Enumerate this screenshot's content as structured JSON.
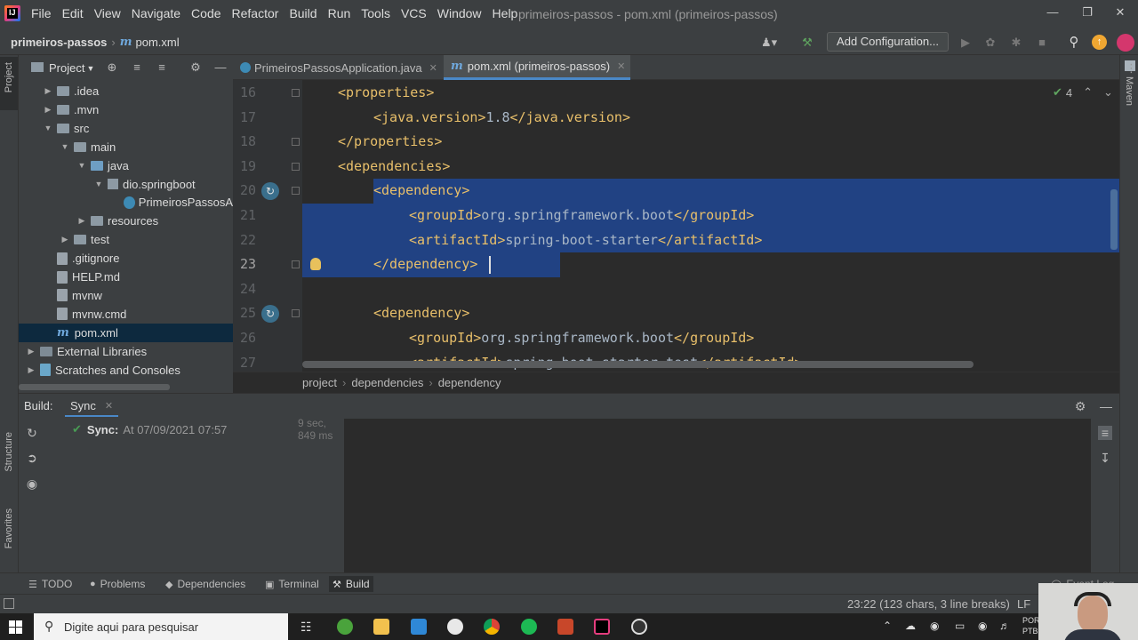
{
  "menubar": {
    "items": [
      "File",
      "Edit",
      "View",
      "Navigate",
      "Code",
      "Refactor",
      "Build",
      "Run",
      "Tools",
      "VCS",
      "Window",
      "Help"
    ],
    "window_title": "primeiros-passos - pom.xml (primeiros-passos)"
  },
  "navbar": {
    "project": "primeiros-passos",
    "file": "pom.xml",
    "add_configuration": "Add Configuration..."
  },
  "left_strip": {
    "project": "Project",
    "structure": "Structure",
    "favorites": "Favorites"
  },
  "right_strip": {
    "maven": "Maven"
  },
  "project_panel": {
    "title": "Project",
    "tree": [
      {
        "label": ".idea",
        "depth": 1,
        "kind": "folder",
        "expand": "collapsed"
      },
      {
        "label": ".mvn",
        "depth": 1,
        "kind": "folder",
        "expand": "collapsed"
      },
      {
        "label": "src",
        "depth": 1,
        "kind": "folder",
        "expand": "expanded"
      },
      {
        "label": "main",
        "depth": 2,
        "kind": "folder",
        "expand": "expanded"
      },
      {
        "label": "java",
        "depth": 3,
        "kind": "folder-blue",
        "expand": "expanded"
      },
      {
        "label": "dio.springboot",
        "depth": 4,
        "kind": "package",
        "expand": "expanded"
      },
      {
        "label": "PrimeirosPassosA",
        "depth": 5,
        "kind": "class",
        "expand": "none"
      },
      {
        "label": "resources",
        "depth": 3,
        "kind": "folder",
        "expand": "collapsed"
      },
      {
        "label": "test",
        "depth": 2,
        "kind": "folder",
        "expand": "collapsed"
      },
      {
        "label": ".gitignore",
        "depth": 1,
        "kind": "file",
        "expand": "none"
      },
      {
        "label": "HELP.md",
        "depth": 1,
        "kind": "file",
        "expand": "none"
      },
      {
        "label": "mvnw",
        "depth": 1,
        "kind": "file",
        "expand": "none"
      },
      {
        "label": "mvnw.cmd",
        "depth": 1,
        "kind": "file",
        "expand": "none"
      },
      {
        "label": "pom.xml",
        "depth": 1,
        "kind": "maven",
        "expand": "none",
        "selected": true
      },
      {
        "label": "External Libraries",
        "depth": 0,
        "kind": "libs",
        "expand": "collapsed"
      },
      {
        "label": "Scratches and Consoles",
        "depth": 0,
        "kind": "scratch",
        "expand": "collapsed"
      }
    ]
  },
  "editor_tabs": [
    {
      "label": "PrimeirosPassosApplication.java",
      "active": false
    },
    {
      "label": "pom.xml (primeiros-passos)",
      "active": true
    }
  ],
  "editor": {
    "inspection_count": "4",
    "lines": [
      {
        "num": "16",
        "indent": 1,
        "parts": [
          [
            "tag",
            "<properties>"
          ]
        ]
      },
      {
        "num": "17",
        "indent": 2,
        "parts": [
          [
            "tag",
            "<java.version>"
          ],
          [
            "txt",
            "1.8"
          ],
          [
            "tag",
            "</java.version>"
          ]
        ]
      },
      {
        "num": "18",
        "indent": 1,
        "parts": [
          [
            "tag",
            "</properties>"
          ]
        ]
      },
      {
        "num": "19",
        "indent": 1,
        "parts": [
          [
            "tag",
            "<dependencies>"
          ]
        ]
      },
      {
        "num": "20",
        "indent": 2,
        "parts": [
          [
            "tag",
            "<dependency>"
          ]
        ]
      },
      {
        "num": "21",
        "indent": 3,
        "parts": [
          [
            "tag",
            "<groupId>"
          ],
          [
            "txt",
            "org.springframework.boot"
          ],
          [
            "tag",
            "</groupId>"
          ]
        ]
      },
      {
        "num": "22",
        "indent": 3,
        "parts": [
          [
            "tag",
            "<artifactId>"
          ],
          [
            "txt",
            "spring-boot-starter"
          ],
          [
            "tag",
            "</artifactId>"
          ]
        ]
      },
      {
        "num": "23",
        "indent": 2,
        "parts": [
          [
            "tag",
            "</dependency>"
          ]
        ]
      },
      {
        "num": "24",
        "indent": 0,
        "parts": []
      },
      {
        "num": "25",
        "indent": 2,
        "parts": [
          [
            "tag",
            "<dependency>"
          ]
        ]
      },
      {
        "num": "26",
        "indent": 3,
        "parts": [
          [
            "tag",
            "<groupId>"
          ],
          [
            "txt",
            "org.springframework.boot"
          ],
          [
            "tag",
            "</groupId>"
          ]
        ]
      },
      {
        "num": "27",
        "indent": 3,
        "parts": [
          [
            "tag",
            "<artifactId>"
          ],
          [
            "txt",
            "spring-boot-starter-test"
          ],
          [
            "tag",
            "</artifactId>"
          ]
        ]
      }
    ],
    "current_line": "23",
    "breadcrumb": [
      "project",
      "dependencies",
      "dependency"
    ]
  },
  "build_panel": {
    "title": "Build:",
    "tab": "Sync",
    "sync_label": "Sync:",
    "sync_time": "At 07/09/2021 07:57",
    "duration": "9 sec, 849 ms"
  },
  "tool_tabs": [
    {
      "label": "TODO",
      "icon": "list-icon",
      "active": false
    },
    {
      "label": "Problems",
      "icon": "problems-icon",
      "active": false
    },
    {
      "label": "Dependencies",
      "icon": "dependencies-icon",
      "active": false
    },
    {
      "label": "Terminal",
      "icon": "terminal-icon",
      "active": false
    },
    {
      "label": "Build",
      "icon": "hammer-icon",
      "active": true
    }
  ],
  "statusbar": {
    "position": "23:22 (123 chars, 3 line breaks)",
    "line_sep": "LF",
    "event_log": "Event Log"
  },
  "taskbar": {
    "search_placeholder": "Digite aqui para pesquisar",
    "lang": "POR",
    "layout": "PTB2"
  },
  "colors": {
    "accent": "#4a88c7",
    "selection": "#214283",
    "xml_tag": "#e8bf6a",
    "xml_text": "#a9b7c6",
    "sync_ok": "#499c54"
  }
}
